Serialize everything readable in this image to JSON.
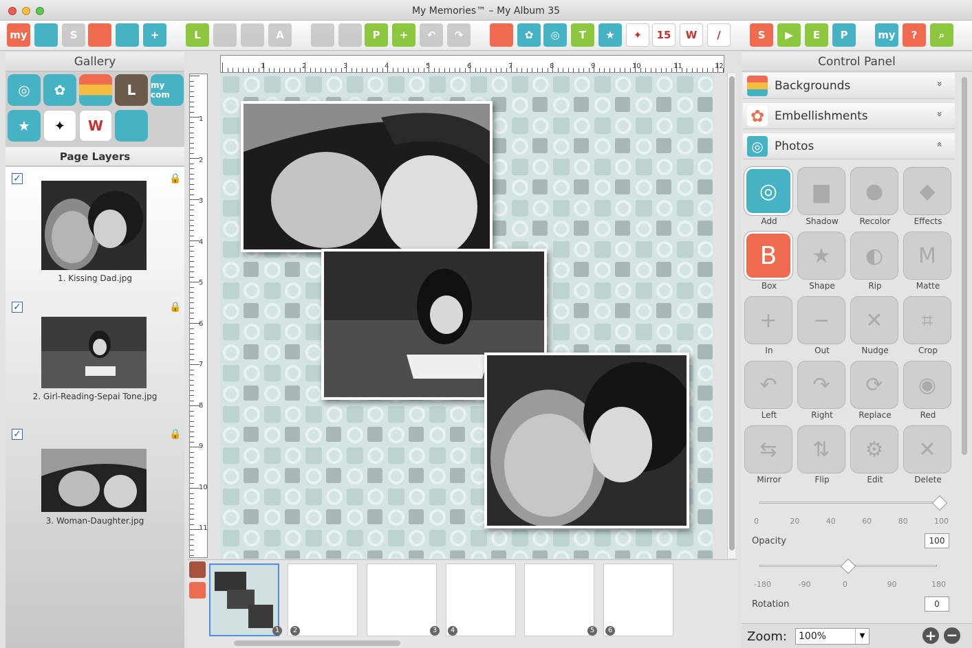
{
  "window": {
    "title": "My Memories™ – My Album 35"
  },
  "toolbar": {
    "buttons": [
      {
        "name": "my-logo-button",
        "label": "my",
        "color": "#ef6b4f"
      },
      {
        "name": "open-folder-button",
        "label": "",
        "color": "#46b3c5"
      },
      {
        "name": "save-button",
        "label": "S",
        "color": "#b9b9b9"
      },
      {
        "name": "layout-button",
        "label": "",
        "color": "#ef6b4f"
      },
      {
        "name": "download-button",
        "label": "",
        "color": "#46b3c5"
      },
      {
        "name": "add-page-button",
        "label": "+",
        "color": "#46b3c5"
      },
      {
        "name": "layouts-button",
        "label": "L",
        "color": "#8dc63f"
      },
      {
        "name": "ruler-button",
        "label": "",
        "color": "#b9b9b9"
      },
      {
        "name": "grid-button",
        "label": "",
        "color": "#b9b9b9"
      },
      {
        "name": "text-style-button",
        "label": "A",
        "color": "#b9b9b9"
      },
      {
        "name": "copy-page-button",
        "label": "",
        "color": "#b9b9b9"
      },
      {
        "name": "paste-page-button",
        "label": "",
        "color": "#b9b9b9"
      },
      {
        "name": "page-button",
        "label": "P",
        "color": "#8dc63f"
      },
      {
        "name": "insert-page-button",
        "label": "+",
        "color": "#8dc63f"
      },
      {
        "name": "undo-button",
        "label": "↶",
        "color": "#b9b9b9"
      },
      {
        "name": "redo-button",
        "label": "↷",
        "color": "#b9b9b9"
      },
      {
        "name": "backgrounds-button",
        "label": "",
        "color": "#ef6b4f"
      },
      {
        "name": "embellishments-button",
        "label": "✿",
        "color": "#46b3c5"
      },
      {
        "name": "photos-button",
        "label": "◎",
        "color": "#46b3c5"
      },
      {
        "name": "text-button",
        "label": "T",
        "color": "#8dc63f"
      },
      {
        "name": "stickers-button",
        "label": "★",
        "color": "#46b3c5"
      },
      {
        "name": "shapes-button",
        "label": "✦",
        "color": "#ffffff"
      },
      {
        "name": "calendar-button",
        "label": "15",
        "color": "#ffffff"
      },
      {
        "name": "word-art-button",
        "label": "W",
        "color": "#ffffff"
      },
      {
        "name": "brush-button",
        "label": "/",
        "color": "#ffffff"
      },
      {
        "name": "spell-check-button",
        "label": "S",
        "color": "#ef6b4f"
      },
      {
        "name": "video-button",
        "label": "▶",
        "color": "#8dc63f"
      },
      {
        "name": "export-button",
        "label": "E",
        "color": "#8dc63f"
      },
      {
        "name": "print-button",
        "label": "P",
        "color": "#46b3c5"
      },
      {
        "name": "online-button",
        "label": "my",
        "color": "#46b3c5"
      },
      {
        "name": "help-button",
        "label": "?",
        "color": "#ef6b4f"
      },
      {
        "name": "search-button",
        "label": "⌕",
        "color": "#8dc63f"
      }
    ]
  },
  "gallery": {
    "title": "Gallery",
    "icons": [
      {
        "name": "photo-gallery-icon",
        "glyph": "◎",
        "color": "#46b3c5"
      },
      {
        "name": "flower-gallery-icon",
        "glyph": "✿",
        "color": "#46b3c5"
      },
      {
        "name": "stripes-gallery-icon",
        "glyph": "",
        "color": "#ef6b4f"
      },
      {
        "name": "layouts-gallery-icon",
        "glyph": "L",
        "color": "#6a5a4a"
      },
      {
        "name": "my-com-gallery-icon",
        "glyph": "my com",
        "color": "#46b3c5"
      },
      {
        "name": "star-gallery-icon",
        "glyph": "★",
        "color": "#46b3c5"
      },
      {
        "name": "butterfly-gallery-icon",
        "glyph": "✦",
        "color": "#ffffff"
      },
      {
        "name": "word-art-gallery-icon",
        "glyph": "W",
        "color": "#ffffff"
      },
      {
        "name": "grid-gallery-icon",
        "glyph": "",
        "color": "#46b3c5"
      }
    ]
  },
  "layers": {
    "title": "Page Layers",
    "items": [
      {
        "label": "1. Kissing Dad.jpg"
      },
      {
        "label": "2. Girl-Reading-Sepai Tone.jpg"
      },
      {
        "label": "3. Woman-Daughter.jpg"
      }
    ]
  },
  "ruler": {
    "top_numbers": [
      "1",
      "2",
      "3",
      "4",
      "5",
      "6",
      "7",
      "8",
      "9",
      "10",
      "11",
      "12"
    ],
    "left_numbers": [
      "1",
      "2",
      "3",
      "4",
      "5",
      "6",
      "7",
      "8",
      "9",
      "10",
      "11"
    ]
  },
  "filmstrip": {
    "page_numbers": [
      "1",
      "2",
      "3",
      "4",
      "5",
      "6"
    ]
  },
  "control_panel": {
    "title": "Control Panel",
    "sections": [
      {
        "label": "Backgrounds",
        "chevron": "»"
      },
      {
        "label": "Embellishments",
        "chevron": "»"
      },
      {
        "label": "Photos",
        "chevron": "«"
      }
    ],
    "tools": [
      {
        "label": "Add",
        "glyph": "◎",
        "active": true
      },
      {
        "label": "Shadow",
        "glyph": "▆",
        "active": false
      },
      {
        "label": "Recolor",
        "glyph": "●",
        "active": false
      },
      {
        "label": "Effects",
        "glyph": "◆",
        "active": false
      },
      {
        "label": "Box",
        "glyph": "B",
        "active": true
      },
      {
        "label": "Shape",
        "glyph": "★",
        "active": false
      },
      {
        "label": "Rip",
        "glyph": "◐",
        "active": false
      },
      {
        "label": "Matte",
        "glyph": "M",
        "active": false
      },
      {
        "label": "In",
        "glyph": "+",
        "active": false
      },
      {
        "label": "Out",
        "glyph": "−",
        "active": false
      },
      {
        "label": "Nudge",
        "glyph": "✕",
        "active": false
      },
      {
        "label": "Crop",
        "glyph": "⌗",
        "active": false
      },
      {
        "label": "Left",
        "glyph": "↶",
        "active": false
      },
      {
        "label": "Right",
        "glyph": "↷",
        "active": false
      },
      {
        "label": "Replace",
        "glyph": "⟳",
        "active": false
      },
      {
        "label": "Red",
        "glyph": "◉",
        "active": false
      },
      {
        "label": "Mirror",
        "glyph": "⇆",
        "active": false
      },
      {
        "label": "Flip",
        "glyph": "⇅",
        "active": false
      },
      {
        "label": "Edit",
        "glyph": "⚙",
        "active": false
      },
      {
        "label": "Delete",
        "glyph": "✕",
        "active": false
      }
    ],
    "opacity": {
      "label": "Opacity",
      "value": "100",
      "fraction": 1.0,
      "ticks": [
        "0",
        "20",
        "40",
        "60",
        "80",
        "100"
      ]
    },
    "rotation": {
      "label": "Rotation",
      "value": "0",
      "fraction": 0.5,
      "ticks": [
        "-180",
        "-90",
        "0",
        "90",
        "180"
      ]
    }
  },
  "zoom": {
    "label": "Zoom:",
    "value": "100%"
  }
}
